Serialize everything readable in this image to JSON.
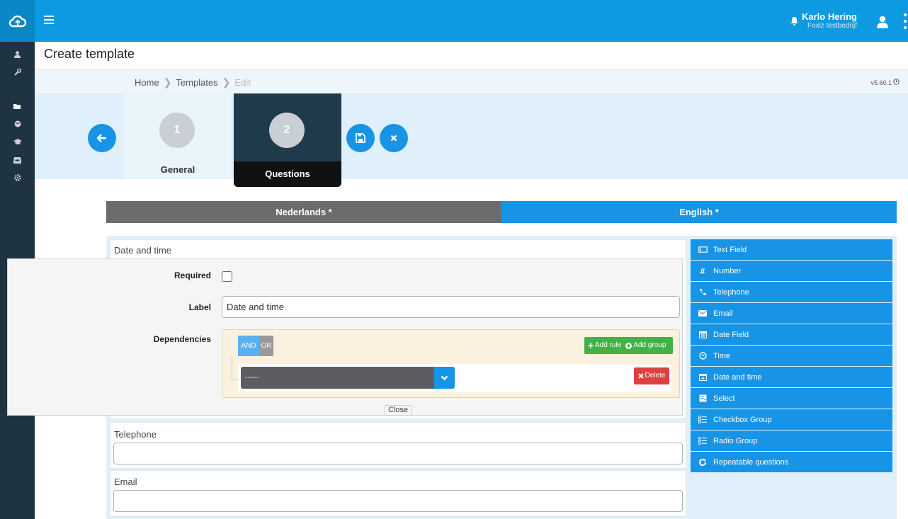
{
  "header": {
    "user_name": "Karlo Hering",
    "company": "Foxiz testbedrijf"
  },
  "page": {
    "title": "Create template",
    "version": "v5.60.1"
  },
  "breadcrumb": {
    "home": "Home",
    "templates": "Templates",
    "edit": "Edit"
  },
  "wizard": {
    "steps": [
      {
        "number": "1",
        "label": "General"
      },
      {
        "number": "2",
        "label": "Questions"
      }
    ]
  },
  "language_tabs": {
    "nl": "Nederlands *",
    "en": "English *"
  },
  "questions": {
    "date_time": {
      "title": "Date and time",
      "required_label": "Required",
      "label_label": "Label",
      "label_value": "Date and time",
      "dependencies_label": "Dependencies",
      "and": "AND",
      "or": "OR",
      "add_rule": "Add rule",
      "add_group": "Add group",
      "rule_select_value": "------",
      "delete": "Delete",
      "close": "Close"
    },
    "telephone": {
      "title": "Telephone"
    },
    "email": {
      "title": "Email"
    }
  },
  "palette": [
    {
      "label": "Text Field",
      "icon": "text-field-icon"
    },
    {
      "label": "Number",
      "icon": "hash-icon"
    },
    {
      "label": "Telephone",
      "icon": "phone-icon"
    },
    {
      "label": "Email",
      "icon": "envelope-icon"
    },
    {
      "label": "Date Field",
      "icon": "calendar-icon"
    },
    {
      "label": "Time",
      "icon": "clock-icon"
    },
    {
      "label": "Date and time",
      "icon": "calendar-plus-icon"
    },
    {
      "label": "Select",
      "icon": "select-icon"
    },
    {
      "label": "Checkbox Group",
      "icon": "checklist-icon"
    },
    {
      "label": "Radio Group",
      "icon": "radiolist-icon"
    },
    {
      "label": "Repeatable questions",
      "icon": "repeat-icon"
    }
  ],
  "colors": {
    "topbar": "#0e9ae0",
    "sidebar": "#1e3442",
    "accent": "#1894e6",
    "success": "#44b048",
    "danger": "#df4040"
  }
}
